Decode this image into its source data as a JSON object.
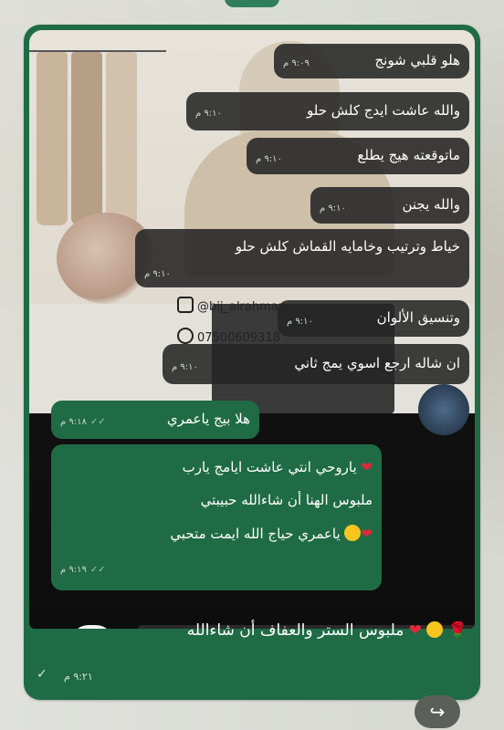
{
  "messages": [
    {
      "text": "هلو قلبي شونج",
      "time": "٩:٠٩ م"
    },
    {
      "text": "والله عاشت ايدج كلش حلو",
      "time": "٩:١٠ م"
    },
    {
      "text": "ماتوقعته هيج يطلع",
      "time": "٩:١٠ م"
    },
    {
      "text": "والله يجنن",
      "time": "٩:١٠ م"
    },
    {
      "text": "خياط وترتيب وخامايه القماش كلش حلو",
      "time": "٩:١٠ م"
    },
    {
      "text": "وتنسيق الألوان",
      "time": "٩:١٠ م"
    },
    {
      "text": "ان شاله ارجع اسوي يمج ثاني",
      "time": "٩:١٠ م"
    },
    {
      "text": "هلا بيج ياعمري",
      "time": "٩:١٨ م"
    }
  ],
  "long_message": {
    "line1": "ياروحي انتي عاشت ايامج يارب",
    "line2": "ملبوس الهنا أن شاءالله حبيبتي",
    "line3": "ياعمري حياج الله ايمت متحبي",
    "time": "٩:١٩ م"
  },
  "photo": {
    "instagram": "@bij_alrahman",
    "phone": "07500609318"
  },
  "forwarded": {
    "text": "ملبوس الستر والعفاف أن شاءالله",
    "time": "٩:٢١ م"
  },
  "icons": {
    "reply": "share-forward-icon",
    "check": "check-icon"
  },
  "colors": {
    "bubble_green": "#1f6b45",
    "bubble_dark": "#242424",
    "heart": "#e0283a"
  }
}
